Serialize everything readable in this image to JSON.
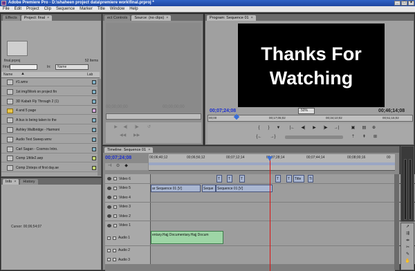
{
  "window": {
    "title": "Adobe Premiere Pro - D:\\shaheen project data\\premiere work\\final.prproj *",
    "buttons": [
      "_",
      "□",
      "×"
    ]
  },
  "menu": [
    "File",
    "Edit",
    "Project",
    "Clip",
    "Sequence",
    "Marker",
    "Title",
    "Window",
    "Help"
  ],
  "project_panel": {
    "tabs": [
      "Effects",
      "Project: final"
    ],
    "project_name": "final.prproj",
    "item_count": "52 Items",
    "find_label": "Find:",
    "in_label": "In:",
    "in_value": "Name",
    "col_name": "Name",
    "col_label": "Lab",
    "items": [
      {
        "name": "#1.wmv",
        "color": "#7fb3c9",
        "type": "clip"
      },
      {
        "name": "1st img/Work on project fin",
        "color": "#7fb3c9",
        "type": "clip"
      },
      {
        "name": "3D Kabah Fly Through 2 (1)",
        "color": "#7fb3c9",
        "type": "clip"
      },
      {
        "name": "4 and 5 page",
        "color": "#d8a8e0",
        "type": "folder"
      },
      {
        "name": "A bus is being taken to the",
        "color": "#7fb3c9",
        "type": "clip"
      },
      {
        "name": "Ashley Wallbridge - Harmoni",
        "color": "#7fb3c9",
        "type": "clip"
      },
      {
        "name": "Audio Text Sweep.wmv",
        "color": "#7fb3c9",
        "type": "clip"
      },
      {
        "name": "Carl Sagan - Cosmos Intro.",
        "color": "#7fb3c9",
        "type": "clip"
      },
      {
        "name": "Comp 1/title2.aep",
        "color": "#c4d96f",
        "type": "clip"
      },
      {
        "name": "Comp 2/steps of first day.ae",
        "color": "#c4d96f",
        "type": "clip"
      }
    ]
  },
  "info_panel": {
    "tabs": [
      "Info",
      "History"
    ],
    "cursor_label": "Cursor: 00;06;54;07"
  },
  "source_panel": {
    "tabs": [
      "ect Controls",
      "Source: (no clips)"
    ],
    "timecode_left": "00;00;00;00",
    "timecode_right": "00;00;00;00"
  },
  "program_panel": {
    "tab": "Program: Sequence 01",
    "screen_line1": "Thanks For",
    "screen_line2": "Watching",
    "timecode_current": "00;07;24;08",
    "zoom": "50%",
    "timecode_duration": "00;46;14;08",
    "ruler_labels": [
      "00;00",
      "00;17;05;02",
      "00;34;10;02",
      "00;51;15;02"
    ]
  },
  "timeline_panel": {
    "tab": "Timeline: Sequence 01",
    "timecode": "00;07;24;08",
    "ruler_labels": [
      "00;06;40;12",
      "00;06;56;12",
      "00;07;12;14",
      "00;07;28;14",
      "00;07;44;14",
      "00;08;00;16",
      "00"
    ],
    "video_tracks": [
      {
        "name": "Video 6",
        "clips": [
          {
            "label": "T"
          },
          {
            "label": "T"
          },
          {
            "label": "T"
          },
          {
            "label": "T"
          },
          {
            "label": "T"
          },
          {
            "label": "Title"
          },
          {
            "label": "Ti"
          }
        ]
      },
      {
        "name": "Video 5",
        "clips": [
          {
            "label": "ar Sequence 01 [V]"
          },
          {
            "label": "Seque"
          },
          {
            "label": "Sequence 01 [V]"
          }
        ]
      },
      {
        "name": "Video 4",
        "clips": []
      },
      {
        "name": "Video 3",
        "clips": []
      },
      {
        "name": "Video 2",
        "clips": []
      },
      {
        "name": "Video 1",
        "clips": []
      }
    ],
    "audio_tracks": [
      {
        "name": "Audio 1",
        "clips": [
          {
            "label": "entary.Hajj Documentary.Hajj Docum"
          }
        ]
      },
      {
        "name": "Audio 2",
        "clips": []
      },
      {
        "name": "Audio 3",
        "clips": []
      }
    ]
  }
}
